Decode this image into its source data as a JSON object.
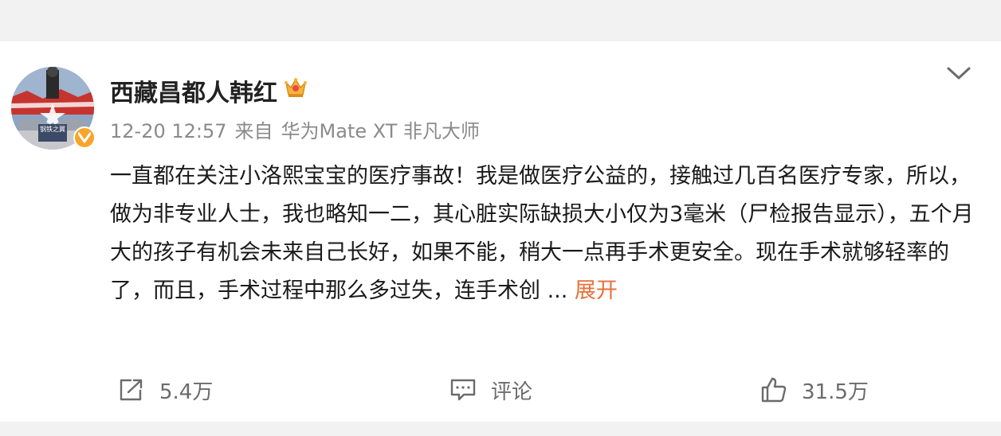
{
  "post": {
    "author": "西藏昌都人韩红",
    "badge_icon": "crown-icon",
    "verified_icon": "verified-v-icon",
    "avatar_text": "钢铁之翼",
    "time": "12-20 12:57",
    "source_prefix": "来自",
    "source": "华为Mate XT 非凡大师",
    "text": "一直都在关注小洛熙宝宝的医疗事故！我是做医疗公益的，接触过几百名医疗专家，所以，做为非专业人士，我也略知一二，其心脏实际缺损大小仅为3毫米（尸检报告显示），五个月大的孩子有机会未来自己长好，如果不能，稍大一点再手术更安全。现在手术就够轻率的了，而且，手术过程中那么多过失，连手术创",
    "ellipsis": " ... ",
    "expand_label": "展开"
  },
  "actions": {
    "share_icon": "share-icon",
    "share_count": "5.4万",
    "comment_icon": "comment-icon",
    "comment_label": "评论",
    "like_icon": "thumbs-up-icon",
    "like_count": "31.5万"
  },
  "colors": {
    "accent": "#e8703a",
    "meta": "#8a8a8a",
    "verified": "#f7a52a",
    "background": "#f2f2f3"
  }
}
